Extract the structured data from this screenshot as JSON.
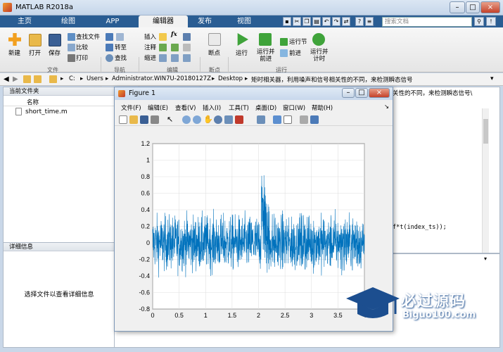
{
  "window": {
    "title": "MATLAB R2018a",
    "minimize": "–",
    "maximize": "□",
    "close": "×"
  },
  "tabs": [
    {
      "label": "主页",
      "active": false
    },
    {
      "label": "绘图",
      "active": false
    },
    {
      "label": "APP",
      "active": false
    },
    {
      "label": "编辑器",
      "active": true
    },
    {
      "label": "发布",
      "active": false
    },
    {
      "label": "视图",
      "active": false
    }
  ],
  "search": {
    "placeholder": "搜索文档"
  },
  "quick_buttons": [
    "?",
    "≡",
    "◄",
    "►",
    "⌂"
  ],
  "toolstrip": {
    "file": {
      "section": "文件",
      "new": "新建",
      "open": "打开",
      "save": "保存",
      "find_files": "查找文件",
      "compare": "比较",
      "print": "打印"
    },
    "navigate": {
      "section": "导航",
      "goto": "转至",
      "find": "查找"
    },
    "edit": {
      "section": "编辑",
      "insert": "插入",
      "comment": "注释",
      "indent": "缩进",
      "fx": "fx"
    },
    "breakpoints": {
      "section": "断点",
      "label": "断点"
    },
    "run": {
      "section": "运行",
      "run": "运行",
      "run_advance": "运行并\n前进",
      "run_section": "运行节",
      "advance": "前进",
      "run_time": "运行并\n计时"
    }
  },
  "address": {
    "path": [
      "C:",
      "Users",
      "Administrator.WIN7U-20180127Z",
      "Desktop",
      "矩时相关器，利用噪声和信号相关性的不同，来检测瞬态信号"
    ]
  },
  "current_folder": {
    "title": "当前文件夹",
    "column": "名称",
    "files": [
      "short_time.m"
    ]
  },
  "details": {
    "title": "详细信息",
    "message": "选择文件以查看详细信息"
  },
  "editor": {
    "tab_text": "关性的不同，来检测瞬态信号\\",
    "code_snippet": "f*t(index_ts));"
  },
  "figure": {
    "title": "Figure 1",
    "menu": [
      "文件(F)",
      "编辑(E)",
      "查看(V)",
      "插入(I)",
      "工具(T)",
      "桌面(D)",
      "窗口(W)",
      "帮助(H)"
    ]
  },
  "chart_data": {
    "type": "line",
    "title": "",
    "xlabel": "",
    "ylabel": "",
    "xlim": [
      0,
      4
    ],
    "ylim": [
      -0.8,
      1.2
    ],
    "xticks": [
      "0",
      "0.5",
      "1",
      "1.5",
      "2",
      "2.5",
      "3",
      "3.5",
      "4"
    ],
    "yticks": [
      "-0.8",
      "-0.6",
      "-0.4",
      "-0.2",
      "0",
      "0.2",
      "0.4",
      "0.6",
      "0.8",
      "1",
      "1.2"
    ],
    "grid": true,
    "series": [
      {
        "color": "#0072bd",
        "noise_amplitude": 0.3,
        "transient_start": 2.05,
        "transient_end": 2.2,
        "transient_peak": 1.1
      }
    ]
  },
  "watermark": {
    "title": "必过源码",
    "url": "Biguo100.com"
  },
  "colors": {
    "tab_bar": "#2a5d93",
    "plot_line": "#0072bd",
    "watermark": "#1c4e8f"
  }
}
